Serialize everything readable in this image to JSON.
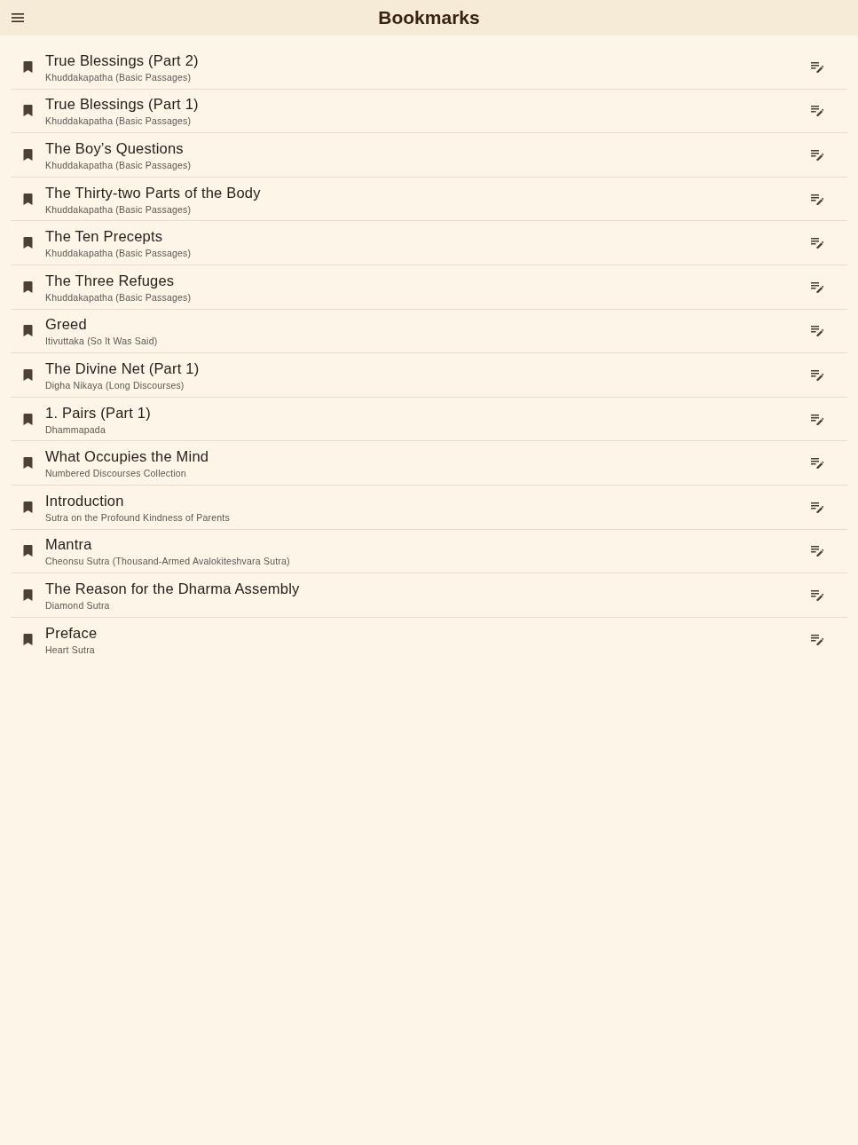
{
  "app_bar": {
    "title": "Bookmarks"
  },
  "bookmarks": [
    {
      "title": "True Blessings (Part 2)",
      "source": "Khuddakapatha (Basic Passages)"
    },
    {
      "title": "True Blessings (Part 1)",
      "source": "Khuddakapatha (Basic Passages)"
    },
    {
      "title": "The Boy’s Questions",
      "source": "Khuddakapatha (Basic Passages)"
    },
    {
      "title": "The Thirty-two Parts of the Body",
      "source": "Khuddakapatha (Basic Passages)"
    },
    {
      "title": "The Ten Precepts",
      "source": "Khuddakapatha (Basic Passages)"
    },
    {
      "title": "The Three Refuges",
      "source": "Khuddakapatha (Basic Passages)"
    },
    {
      "title": "Greed",
      "source": "Itivuttaka (So It Was Said)"
    },
    {
      "title": "The Divine Net (Part 1)",
      "source": "Digha Nikaya (Long Discourses)"
    },
    {
      "title": "1. Pairs (Part 1)",
      "source": "Dhammapada"
    },
    {
      "title": "What Occupies the Mind",
      "source": "Numbered Discourses Collection"
    },
    {
      "title": "Introduction",
      "source": "Sutra on the Profound Kindness of Parents"
    },
    {
      "title": "Mantra",
      "source": "Cheonsu Sutra (Thousand-Armed Avalokiteshvara Sutra)"
    },
    {
      "title": "The Reason for the Dharma Assembly",
      "source": "Diamond Sutra"
    },
    {
      "title": "Preface",
      "source": "Heart Sutra"
    }
  ]
}
